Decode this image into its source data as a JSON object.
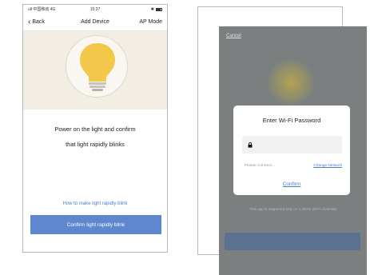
{
  "left_screen": {
    "status": {
      "carrier": "ull 中国移动 4G",
      "time": "15:37"
    },
    "nav": {
      "back_label": "Back",
      "title": "Add Device",
      "right_label": "AP Mode"
    },
    "instruction_line1": "Power on the light and confirm",
    "instruction_line2": "that light rapidly blinks",
    "help_link": "How to make light rapidly blink",
    "confirm_button": "Confirm light rapidly blink",
    "colors": {
      "accent": "#5e87d0",
      "link": "#4a7ccf",
      "hero_bg": "#f3eee4",
      "bulb": "#f3c84a"
    }
  },
  "right_screen": {
    "cancel_label": "Cancel",
    "dialog": {
      "title": "Enter Wi-Fi Password",
      "password_icon": "lock-icon",
      "status_text": "Please Connect...",
      "change_network": "Change Network",
      "confirm_label": "Confirm"
    },
    "support_text": "This app is supported only on 2.4GHz Wi-Fi channels",
    "colors": {
      "overlay": "#7b7f80",
      "link": "#4a7ccf"
    }
  }
}
